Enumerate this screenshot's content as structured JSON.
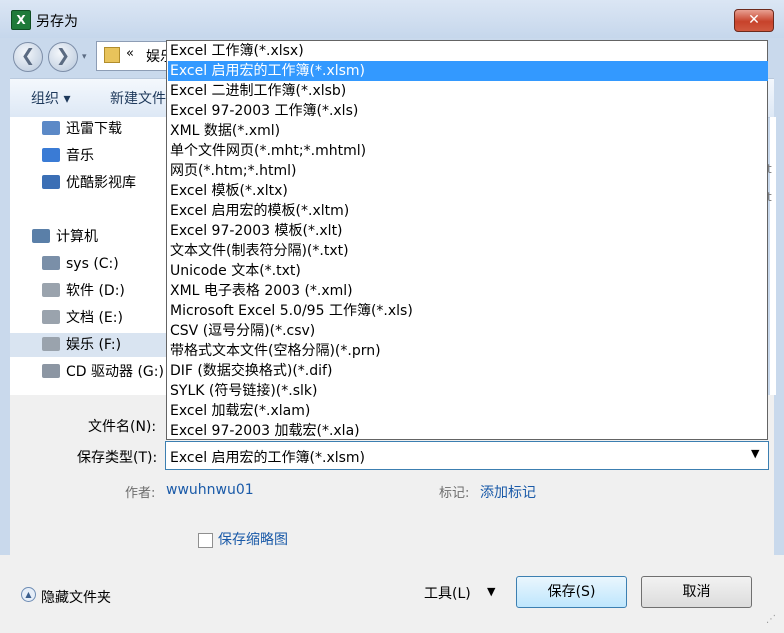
{
  "window": {
    "title": "另存为",
    "close_glyph": "✕",
    "icon_glyph": "X"
  },
  "nav": {
    "back_glyph": "❮",
    "forward_glyph": "❯",
    "dropdown_glyph": "▾",
    "breadcrumb_sep": "«",
    "breadcrumb_text": "娱乐"
  },
  "toolbar": {
    "organize": "组织 ▾",
    "new_folder": "新建文件夹"
  },
  "sidebar": {
    "items": [
      {
        "label": "迅雷下载",
        "icon": "download-icon",
        "color": "#5b89c7"
      },
      {
        "label": "音乐",
        "icon": "music-icon",
        "color": "#3a7bd5"
      },
      {
        "label": "优酷影视库",
        "icon": "video-icon",
        "color": "#3b6fb5"
      },
      {
        "label": "计算机",
        "icon": "computer-icon",
        "color": "#5a7fa8"
      },
      {
        "label": "sys (C:)",
        "icon": "system-drive-icon",
        "color": "#7a8fa8"
      },
      {
        "label": "软件 (D:)",
        "icon": "drive-icon",
        "color": "#9aa3ad"
      },
      {
        "label": "文档 (E:)",
        "icon": "drive-icon",
        "color": "#9aa3ad"
      },
      {
        "label": "娱乐 (F:)",
        "icon": "drive-icon",
        "color": "#9aa3ad"
      },
      {
        "label": "CD 驱动器 (G:)",
        "icon": "cd-drive-icon",
        "color": "#8c96a3"
      }
    ],
    "selected_index": 7
  },
  "right_pane": {
    "snip1": "t",
    "snip2": "t"
  },
  "form": {
    "filename_label": "文件名(N):",
    "filetype_label": "保存类型(T):",
    "filetype_value": "Excel 启用宏的工作簿(*.xlsm)",
    "select_arrow": "▼",
    "author_label": "作者:",
    "author_value": "wwuhnwu01",
    "tags_label": "标记:",
    "tags_value": "添加标记",
    "thumbnail_label": "保存缩略图",
    "thumbnail_checked": false
  },
  "footer": {
    "hide_folders": "隐藏文件夹",
    "hide_folders_glyph": "▲",
    "tools": "工具(L)",
    "tools_arrow": "▼",
    "save": "保存(S)",
    "cancel": "取消",
    "grip": "⋰"
  },
  "filetype_options": [
    "Excel 工作簿(*.xlsx)",
    "Excel 启用宏的工作簿(*.xlsm)",
    "Excel 二进制工作簿(*.xlsb)",
    "Excel 97-2003 工作簿(*.xls)",
    "XML 数据(*.xml)",
    "单个文件网页(*.mht;*.mhtml)",
    "网页(*.htm;*.html)",
    "Excel 模板(*.xltx)",
    "Excel 启用宏的模板(*.xltm)",
    "Excel 97-2003 模板(*.xlt)",
    "文本文件(制表符分隔)(*.txt)",
    "Unicode 文本(*.txt)",
    "XML 电子表格 2003 (*.xml)",
    "Microsoft Excel 5.0/95 工作簿(*.xls)",
    "CSV (逗号分隔)(*.csv)",
    "带格式文本文件(空格分隔)(*.prn)",
    "DIF (数据交换格式)(*.dif)",
    "SYLK (符号链接)(*.slk)",
    "Excel 加载宏(*.xlam)",
    "Excel 97-2003 加载宏(*.xla)"
  ],
  "filetype_selected_index": 1,
  "colors": {
    "accent": "#3399ff",
    "link": "#1a5aa8"
  }
}
